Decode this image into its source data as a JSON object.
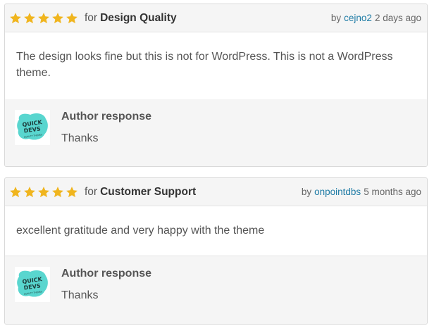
{
  "colors": {
    "star": "#f0b51e",
    "link": "#1e7ba5",
    "logo_blob": "#59d6cf"
  },
  "reviews": [
    {
      "rating": 5,
      "for_label": "for",
      "category": "Design Quality",
      "by_label": "by",
      "author": "cejno2",
      "time": "2 days ago",
      "body": "The design looks fine but this is not for WordPress. This is not a WordPress theme.",
      "response": {
        "title": "Author response",
        "text": "Thanks",
        "avatar_text": "QUICK DEVS"
      }
    },
    {
      "rating": 5,
      "for_label": "for",
      "category": "Customer Support",
      "by_label": "by",
      "author": "onpointdbs",
      "time": "5 months ago",
      "body": "excellent gratitude and very happy with the theme",
      "response": {
        "title": "Author response",
        "text": "Thanks",
        "avatar_text": "QUICK DEVS"
      }
    }
  ]
}
